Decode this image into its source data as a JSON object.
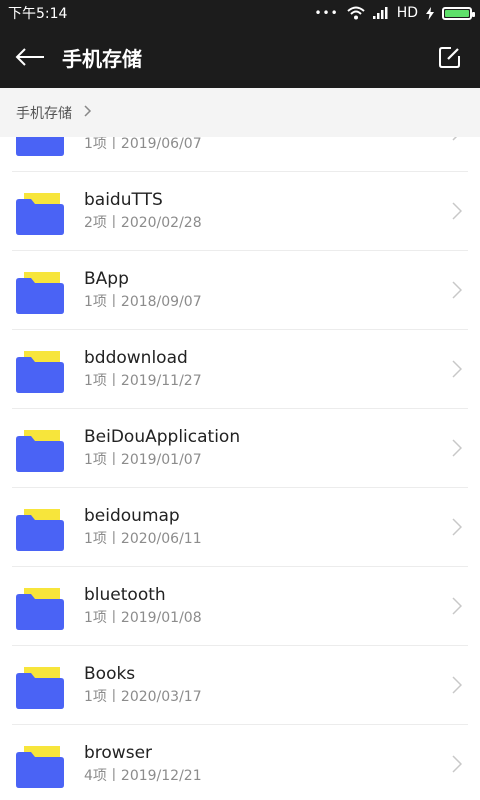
{
  "status_bar": {
    "time": "下午5:14",
    "dots": "•••",
    "network": "HD",
    "battery_level": 1.0
  },
  "header": {
    "title": "手机存储",
    "back_icon": "arrow-left-icon",
    "edit_icon": "edit-icon"
  },
  "breadcrumb": {
    "items": [
      "手机存储"
    ]
  },
  "folders": [
    {
      "name": "",
      "meta": "1项丨2019/06/07"
    },
    {
      "name": "baiduTTS",
      "meta": "2项丨2020/02/28"
    },
    {
      "name": "BApp",
      "meta": "1项丨2018/09/07"
    },
    {
      "name": "bddownload",
      "meta": "1项丨2019/11/27"
    },
    {
      "name": "BeiDouApplication",
      "meta": "1项丨2019/01/07"
    },
    {
      "name": "beidoumap",
      "meta": "1项丨2020/06/11"
    },
    {
      "name": "bluetooth",
      "meta": "1项丨2019/01/08"
    },
    {
      "name": "Books",
      "meta": "1项丨2020/03/17"
    },
    {
      "name": "browser",
      "meta": "4项丨2019/12/21"
    }
  ],
  "colors": {
    "folder_body": "#4a63f5",
    "folder_paper": "#f7e53b",
    "header_bg": "#1c1c1c"
  }
}
